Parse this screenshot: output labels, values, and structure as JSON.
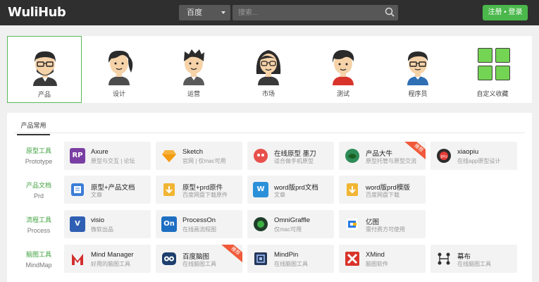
{
  "header": {
    "logo": "WuliHub",
    "search_engine": "百度",
    "search_placeholder": "搜索...",
    "login_label": "注册 • 登录"
  },
  "roles": [
    {
      "label": "产品",
      "active": true
    },
    {
      "label": "设计",
      "active": false
    },
    {
      "label": "运营",
      "active": false
    },
    {
      "label": "市场",
      "active": false
    },
    {
      "label": "测试",
      "active": false
    },
    {
      "label": "程序员",
      "active": false
    },
    {
      "label": "自定义收藏",
      "active": false
    }
  ],
  "tools_tab": "产品常用",
  "categories": [
    {
      "cn": "原型工具",
      "en": "Prototype"
    },
    {
      "cn": "产品文档",
      "en": "Prd"
    },
    {
      "cn": "流程工具",
      "en": "Process"
    },
    {
      "cn": "脑图工具",
      "en": "MindMap"
    }
  ],
  "tools": [
    [
      {
        "name": "Axure",
        "desc": "原型与交互 | 论坛",
        "icon": "axure-icon"
      },
      {
        "name": "Sketch",
        "desc": "官网 | 仅mac可用",
        "icon": "sketch-icon"
      },
      {
        "name": "在线原型 墨刀",
        "desc": "适合做手机原型",
        "icon": "modao-icon"
      },
      {
        "name": "产品大牛",
        "desc": "原型托管与原型交流",
        "icon": "pmdaniu-icon",
        "badge": "推荐"
      },
      {
        "name": "xiaopiu",
        "desc": "在线app原型设计",
        "icon": "xiaopiu-icon"
      }
    ],
    [
      {
        "name": "原型+产品文档",
        "desc": "文章",
        "icon": "doc-icon"
      },
      {
        "name": "原型+prd原件",
        "desc": "百度网盘下载原件",
        "icon": "download-icon"
      },
      {
        "name": "word版prd文档",
        "desc": "文章",
        "icon": "word-icon"
      },
      {
        "name": "word版prd模版",
        "desc": "百度网盘下载",
        "icon": "download-icon"
      }
    ],
    [
      {
        "name": "visio",
        "desc": "微软出品",
        "icon": "visio-icon"
      },
      {
        "name": "ProcessOn",
        "desc": "在线画流程图",
        "icon": "processon-icon"
      },
      {
        "name": "OmniGraffle",
        "desc": "仅mac可用",
        "icon": "omnigraffle-icon"
      },
      {
        "name": "亿图",
        "desc": "需付费方可使用",
        "icon": "edraw-icon"
      }
    ],
    [
      {
        "name": "Mind Manager",
        "desc": "好用的脑图工具",
        "icon": "mindmanager-icon"
      },
      {
        "name": "百度脑图",
        "desc": "在线脑图工具",
        "icon": "naotu-icon",
        "badge": "推荐"
      },
      {
        "name": "MindPin",
        "desc": "在线脑图工具",
        "icon": "mindpin-icon"
      },
      {
        "name": "XMind",
        "desc": "脑图软件",
        "icon": "xmind-icon"
      },
      {
        "name": "幕布",
        "desc": "在线脑图工具",
        "icon": "mubu-icon"
      }
    ]
  ],
  "colors": {
    "topbar": "#2f2f2f",
    "accent": "#4bb84b",
    "category": "#3ea03e",
    "badge": "#f05a3a"
  }
}
